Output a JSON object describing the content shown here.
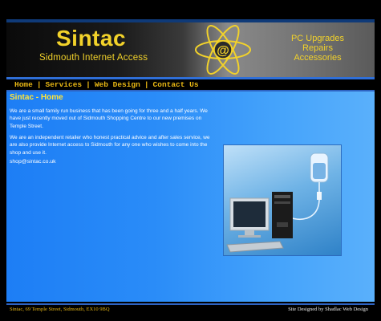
{
  "header": {
    "brand": "Sintac",
    "tagline": "Sidmouth Internet Access",
    "services": [
      "PC Upgrades",
      "Repairs",
      "Accessories"
    ],
    "logo_icon": "atom-at-icon"
  },
  "nav": {
    "items": [
      "Home",
      "Services",
      "Web Design",
      "Contact Us"
    ],
    "separator": "|"
  },
  "main": {
    "title": "Sintac - Home",
    "paragraphs": [
      "We are a small family run business that has been going for three and a half years. We have just recently moved out of Sidmouth Shopping Centre to our new premises on Temple Street.",
      "We are an independent retailer who honest practical advice and after sales service, we are also provide Internet access to Sidmouth for any one who wishes to come into the shop and use it."
    ],
    "email": "shop@sintac.co.uk",
    "image_icon": "computer-iv-drip-image"
  },
  "footer": {
    "address": "Sintac, 69 Temple Street, Sidmouth, EX10 9BQ",
    "credit": "Site Designed by Shadlac Web Design"
  },
  "colors": {
    "accent_yellow": "#f2d22a",
    "nav_text": "#e8b714",
    "content_blue": "#2a8cf8",
    "title_yellow": "#ffe43a"
  }
}
